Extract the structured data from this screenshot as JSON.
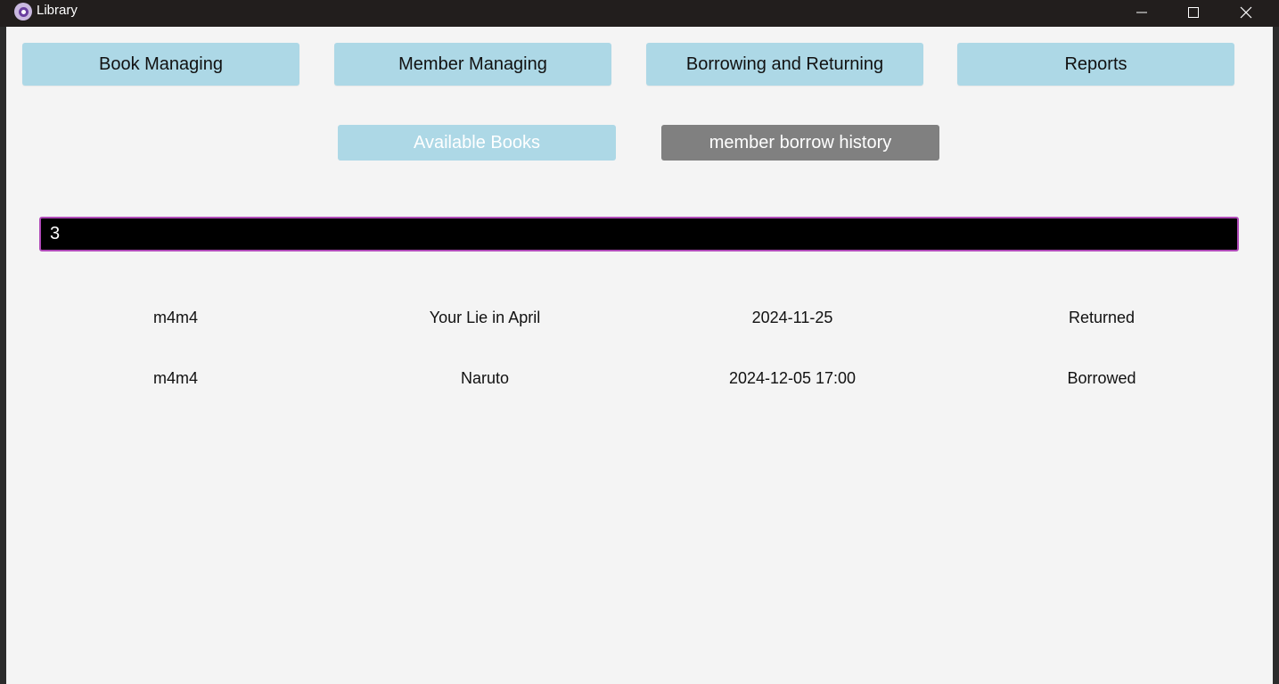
{
  "window": {
    "title": "Library",
    "controls": {
      "minimize_icon": "minimize-icon",
      "maximize_icon": "maximize-icon",
      "close_icon": "close-icon"
    }
  },
  "nav": {
    "book_managing": "Book Managing",
    "member_managing": "Member Managing",
    "borrowing_returning": "Borrowing and Returning",
    "reports": "Reports"
  },
  "subnav": {
    "available_books": "Available Books",
    "member_borrow_history": "member borrow history"
  },
  "search": {
    "value": "3",
    "placeholder": ""
  },
  "history": {
    "rows": [
      {
        "member": "m4m4",
        "book": "Your Lie in April",
        "date": "2024-11-25",
        "status": "Returned"
      },
      {
        "member": "m4m4",
        "book": "Naruto",
        "date": "2024-12-05 17:00",
        "status": "Borrowed"
      }
    ]
  },
  "colors": {
    "accent_button": "#add8e6",
    "active_button": "#808080",
    "input_border": "#b04ab8",
    "titlebar": "#221e1d"
  }
}
